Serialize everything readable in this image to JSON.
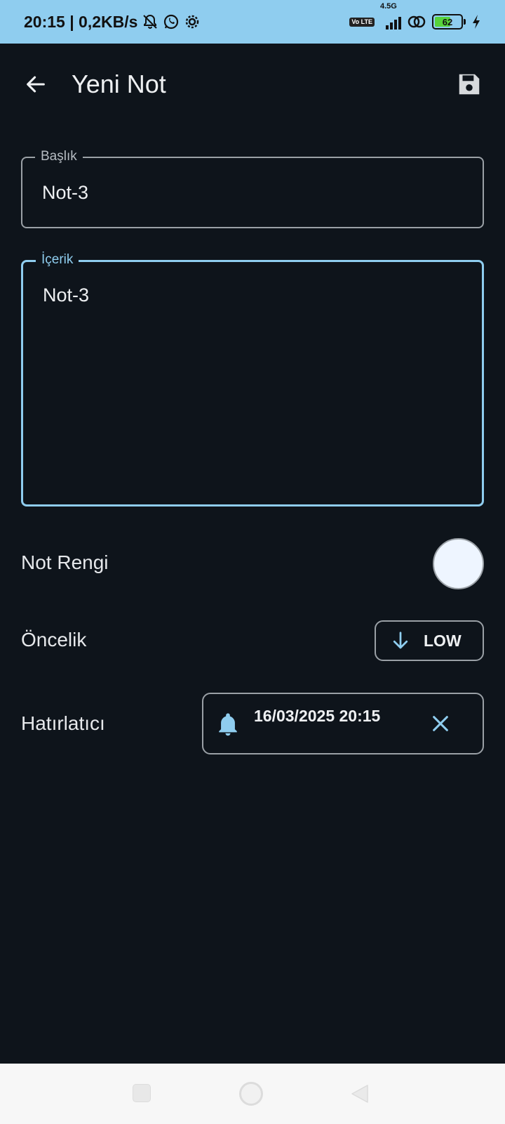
{
  "status_bar": {
    "time_speed": "20:15 | 0,2KB/s",
    "network_label": "4.5G",
    "volte_label": "Vo LTE",
    "battery_level": "62",
    "battery_fraction": 0.62
  },
  "app_bar": {
    "title": "Yeni Not",
    "back_icon": "arrow-left-icon",
    "save_icon": "save-icon"
  },
  "form": {
    "title_field": {
      "label": "Başlık",
      "value": "Not-3"
    },
    "content_field": {
      "label": "İçerik",
      "value": "Not-3"
    }
  },
  "note_color": {
    "label": "Not Rengi",
    "value": "#eef5ff"
  },
  "priority": {
    "label": "Öncelik",
    "value": "LOW",
    "icon": "arrow-down-icon"
  },
  "reminder": {
    "label": "Hatırlatıcı",
    "value": "16/03/2025 20:15",
    "icon": "bell-icon",
    "clear_icon": "close-icon"
  },
  "colors": {
    "accent": "#8fcdef",
    "background": "#0e141b",
    "outline": "#9aa0a6"
  }
}
